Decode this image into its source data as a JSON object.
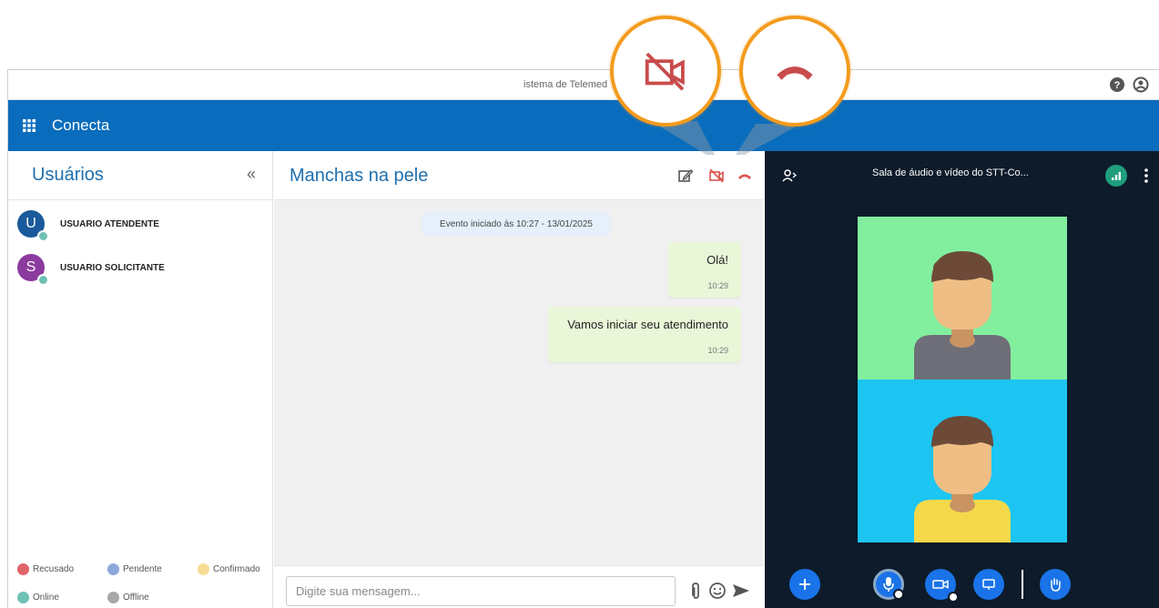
{
  "window": {
    "title": "istema de Telemed",
    "help_icon": "help-circle-icon",
    "account_icon": "account-circle-icon"
  },
  "appbar": {
    "menu_icon": "apps-grid-icon",
    "app_name": "Conecta"
  },
  "users_panel": {
    "title": "Usuários",
    "collapse_label": "«",
    "users": [
      {
        "initial": "U",
        "name": "USUARIO ATENDENTE",
        "avatar_color": "#1a5a9c",
        "status_color": "#6ec1b3"
      },
      {
        "initial": "S",
        "name": "USUARIO SOLICITANTE",
        "avatar_color": "#8b3a9e",
        "status_color": "#6ec1b3"
      }
    ],
    "legend": [
      {
        "label": "Recusado",
        "color": "#e0646a"
      },
      {
        "label": "Pendente",
        "color": "#8ea8dc"
      },
      {
        "label": "Confirmado",
        "color": "#f7de94"
      },
      {
        "label": "Online",
        "color": "#6ec1b3"
      },
      {
        "label": "Offline",
        "color": "#a8a8a8"
      }
    ]
  },
  "chat": {
    "title": "Manchas na pele",
    "header_icons": [
      "edit-icon",
      "video-off-icon",
      "hang-up-icon"
    ],
    "event_text": "Evento iniciado às 10:27 - 13/01/2025",
    "messages": [
      {
        "text": "Olá!",
        "time": "10:29"
      },
      {
        "text": "Vamos iniciar seu atendimento",
        "time": "10:29"
      }
    ],
    "composer": {
      "placeholder": "Digite sua mensagem...",
      "icons": [
        "attach-icon",
        "emoji-icon",
        "send-icon"
      ]
    }
  },
  "video": {
    "room_title": "Sala de áudio e vídeo do STT-Co...",
    "participants_icon": "participants-icon",
    "signal_icon": "signal-icon",
    "more_icon": "more-vertical-icon",
    "tiles": [
      {
        "bg": "#82ef9e",
        "shirt": "#6e6e78"
      },
      {
        "bg": "#1cc5f2",
        "shirt": "#f6d94a"
      }
    ],
    "controls": [
      "add-icon",
      "microphone-icon",
      "camera-icon",
      "screen-share-icon",
      "raise-hand-icon"
    ]
  },
  "callouts": [
    "video-off-icon",
    "hang-up-icon"
  ],
  "colors": {
    "primary": "#0a6cbc",
    "danger": "#d9534f",
    "highlight": "#f39b1d",
    "video_bg": "#0d1b2a"
  }
}
